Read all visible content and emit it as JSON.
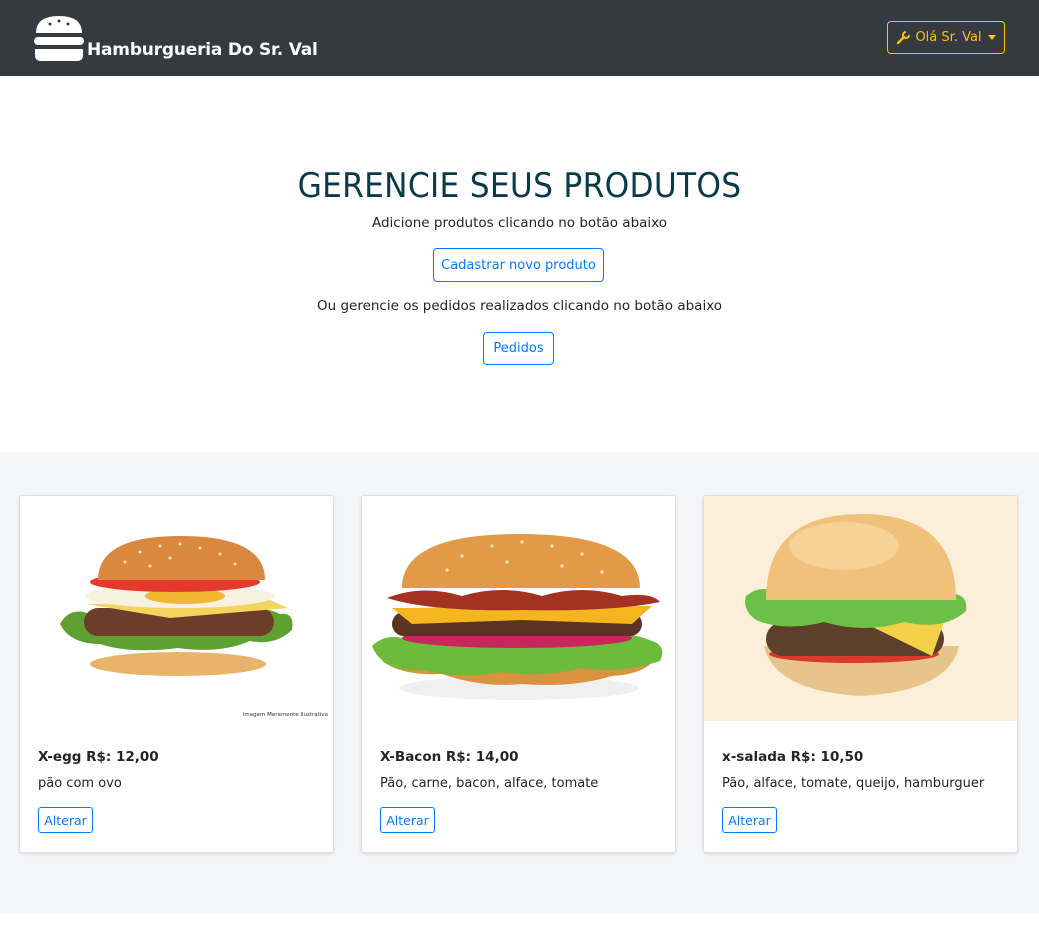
{
  "navbar": {
    "brand_text": "Hamburgueria Do Sr. Val",
    "user_button_label": "Olá Sr. Val",
    "icons": {
      "logo": "burger-logo-icon",
      "user": "wrench-icon",
      "caret": "caret-down-icon"
    },
    "colors": {
      "background": "#343a40",
      "accent": "#ffc107"
    }
  },
  "hero": {
    "title": "GERENCIE SEUS PRODUTOS",
    "subtitle_products": "Adicione produtos clicando no botão abaixo",
    "new_product_button": "Cadastrar novo produto",
    "subtitle_orders": "Ou gerencie os pedidos realizados clicando no botão abaixo",
    "orders_button": "Pedidos"
  },
  "products": [
    {
      "title": "X-egg R$: 12,00",
      "description": "pão com ovo",
      "button": "Alterar",
      "image": "x-egg-burger-photo",
      "image_caption": "Imagem Meramente Ilustrativa"
    },
    {
      "title": "X-Bacon R$: 14,00",
      "description": "Pão, carne, bacon, alface, tomate",
      "button": "Alterar",
      "image": "x-bacon-burger-photo"
    },
    {
      "title": "x-salada R$: 10,50",
      "description": "Pão, alface, tomate, queijo, hamburguer",
      "button": "Alterar",
      "image": "x-salada-burger-photo"
    }
  ],
  "colors": {
    "primary": "#007bff",
    "section_background": "#f5f6f8",
    "title": "#0a3a4a"
  }
}
